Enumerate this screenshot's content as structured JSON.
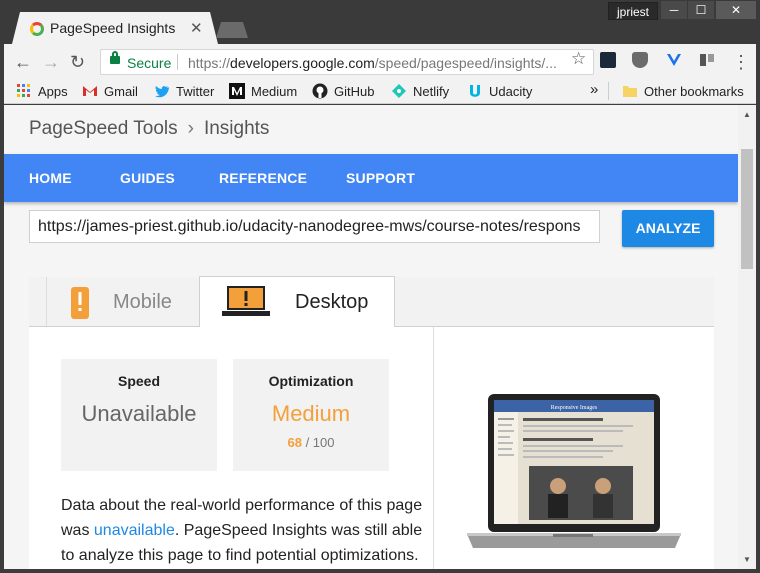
{
  "window": {
    "user": "jpriest",
    "controls": {
      "minimize": "─",
      "maximize": "☐",
      "close": "✕"
    }
  },
  "browser": {
    "tab_title": "PageSpeed Insights",
    "tab_close": "✕",
    "secure_label": "Secure",
    "url_scheme": "https://",
    "url_host": "developers.google.com",
    "url_path": "/speed/pagespeed/insights/...",
    "nav": {
      "back": "←",
      "forward": "→",
      "reload": "↻"
    },
    "star": "☆",
    "menu": "⋮",
    "bookmarks": [
      {
        "label": "Apps",
        "icon": "apps-grid-icon"
      },
      {
        "label": "Gmail",
        "icon": "gmail-icon"
      },
      {
        "label": "Twitter",
        "icon": "twitter-icon"
      },
      {
        "label": "Medium",
        "icon": "medium-icon"
      },
      {
        "label": "GitHub",
        "icon": "github-icon"
      },
      {
        "label": "Netlify",
        "icon": "netlify-icon"
      },
      {
        "label": "Udacity",
        "icon": "udacity-icon"
      }
    ],
    "bookmarks_overflow": "»",
    "other_bookmarks": "Other bookmarks"
  },
  "page": {
    "breadcrumb": {
      "parent": "PageSpeed Tools",
      "separator": "›",
      "current": "Insights"
    },
    "nav": [
      "HOME",
      "GUIDES",
      "REFERENCE",
      "SUPPORT"
    ],
    "url_value": "https://james-priest.github.io/udacity-nanodegree-mws/course-notes/respons",
    "analyze_label": "ANALYZE",
    "tabs": {
      "mobile": "Mobile",
      "desktop": "Desktop",
      "selected": "Desktop"
    },
    "cards": [
      {
        "title": "Speed",
        "value": "Unavailable",
        "value_color": "#666666"
      },
      {
        "title": "Optimization",
        "value": "Medium",
        "value_color": "#f4a03a",
        "score": "68",
        "score_sep": " / ",
        "score_max": "100"
      }
    ],
    "paragraph": {
      "before": "Data about the real-world performance of this page was ",
      "link": "unavailable",
      "after": ". PageSpeed Insights was still able to analyze this page to find potential optimizations."
    },
    "preview": {
      "heading": "Responsive Images"
    }
  },
  "colors": {
    "accent": "#4285f4",
    "button": "#1e88e5",
    "medium": "#f4a03a"
  }
}
